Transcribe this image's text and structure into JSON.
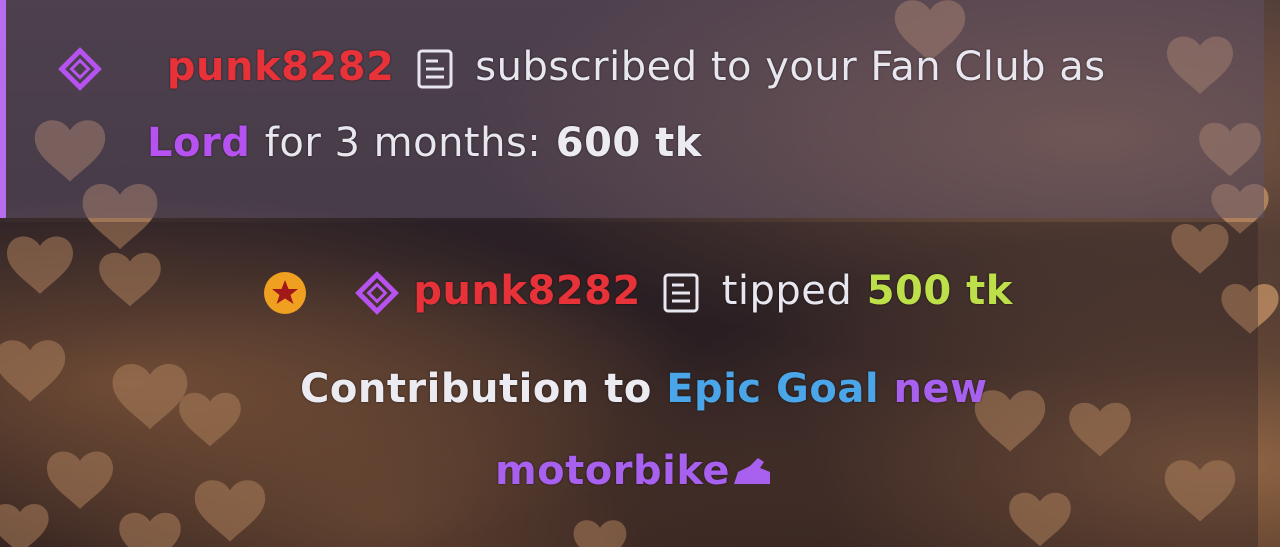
{
  "subscription": {
    "username": "punk8282",
    "text_before_role": "subscribed to your Fan Club as",
    "role": "Lord",
    "text_after_role": "for 3 months:",
    "amount": "600 tk"
  },
  "tip": {
    "username": "punk8282",
    "action": "tipped",
    "amount": "500 tk",
    "contribution_prefix": "Contribution to",
    "goal_name": "Epic Goal",
    "goal_word": "new",
    "goal_item": "motorbike"
  },
  "colors": {
    "username": "#e8323a",
    "role": "#b653f0",
    "amount": "#bde04a",
    "goal": "#4aa6e8",
    "accent_border": "#b86cf0"
  },
  "icons": {
    "fan_club": "diamond-icon",
    "notes": "notes-icon",
    "top_tipper": "star-badge-icon",
    "goal_item": "motorbike-icon"
  }
}
